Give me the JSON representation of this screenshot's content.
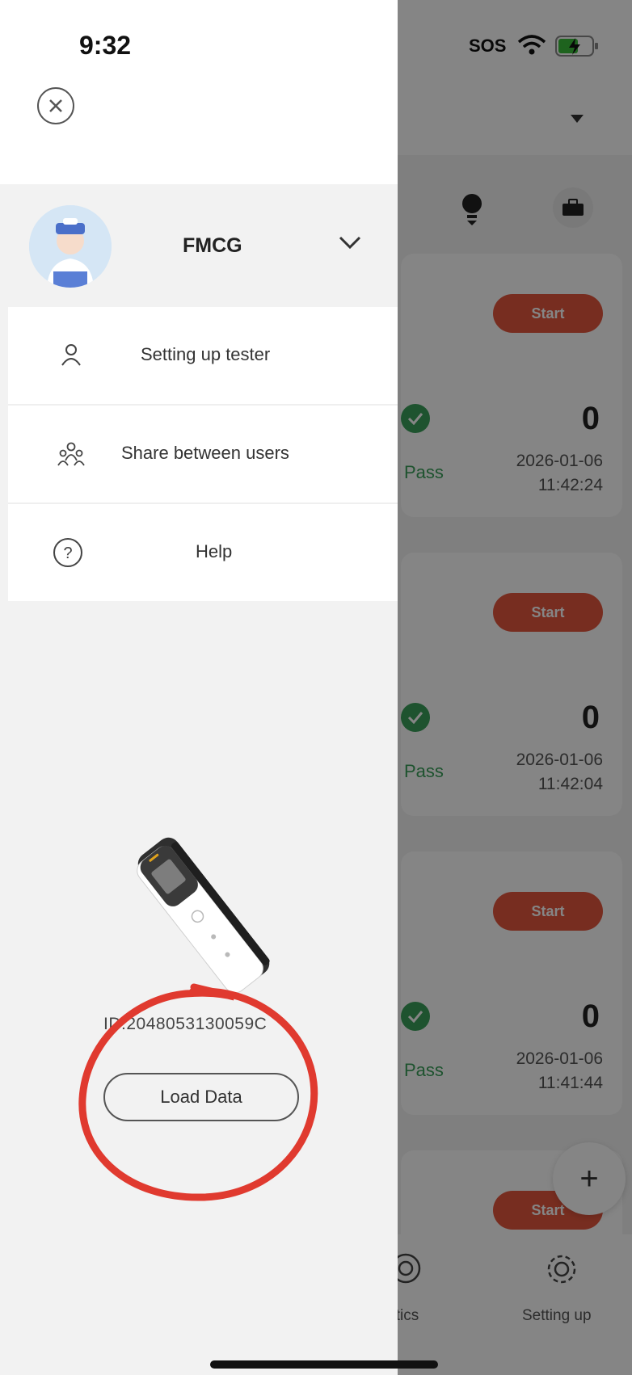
{
  "status_bar": {
    "time": "9:32",
    "sos": "SOS",
    "icons": [
      "wifi-icon",
      "battery-charging-icon"
    ]
  },
  "drawer": {
    "close_icon": "close-circle-icon",
    "profile": {
      "name": "FMCG",
      "avatar_icon": "user-avatar-icon",
      "expand_icon": "chevron-down-icon"
    },
    "menu": [
      {
        "label": "Setting up tester",
        "icon": "person-icon"
      },
      {
        "label": "Share between users",
        "icon": "users-share-icon"
      },
      {
        "label": "Help",
        "icon": "question-circle-icon"
      }
    ],
    "device": {
      "id_text": "ID:2048053130059C",
      "load_button": "Load Data",
      "image_icon": "tester-device-icon"
    },
    "annotation_color": "#e03a2f"
  },
  "background": {
    "cards": [
      {
        "button": "Start",
        "count": "0",
        "status": "Pass",
        "date": "2026-01-06",
        "time": "11:42:24"
      },
      {
        "button": "Start",
        "count": "0",
        "status": "Pass",
        "date": "2026-01-06",
        "time": "11:42:04"
      },
      {
        "button": "Start",
        "count": "0",
        "status": "Pass",
        "date": "2026-01-06",
        "time": "11:41:44"
      },
      {
        "button": "Start"
      }
    ],
    "fab": "+",
    "nav": [
      {
        "label": "Analytics",
        "visible_label": "lytics",
        "icon": "analytics-icon"
      },
      {
        "label": "Setting up",
        "icon": "gear-icon"
      }
    ],
    "accent_color": "#e4573e",
    "pass_color": "#3aa05a"
  }
}
